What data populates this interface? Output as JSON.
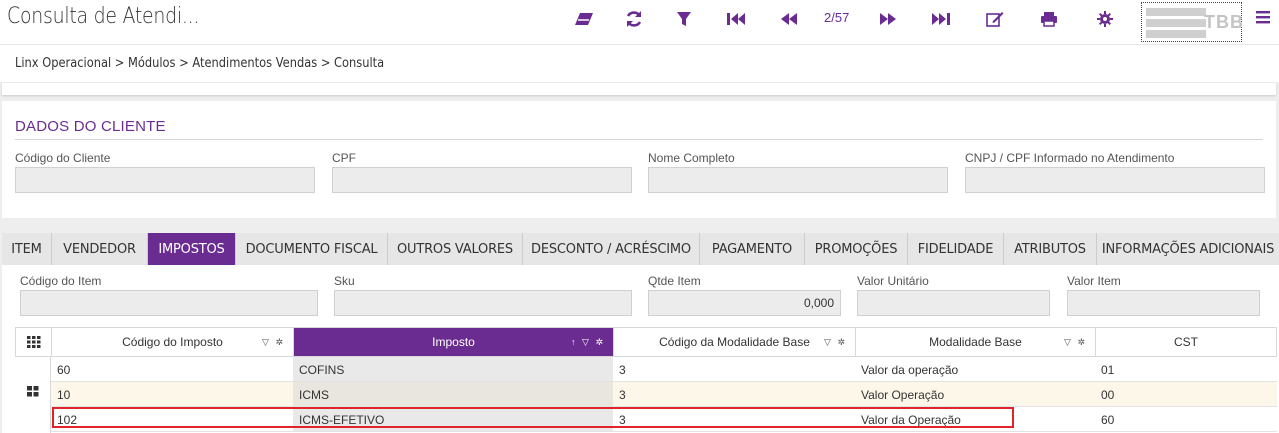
{
  "app": {
    "title": "Consulta de Atendi..."
  },
  "toolbar": {
    "pager": "2/57",
    "logo_text": "TBB",
    "icons": [
      "eraser-icon",
      "refresh-icon",
      "filter-icon",
      "first-icon",
      "prev-icon",
      "next-icon",
      "last-icon",
      "edit-icon",
      "print-icon",
      "gear-icon",
      "menu-icon"
    ]
  },
  "breadcrumb": "Linx Operacional  >  Módulos  >  Atendimentos Vendas  >  Consulta",
  "cliente": {
    "title": "DADOS DO CLIENTE",
    "fields": [
      {
        "label": "Código do Cliente",
        "value": ""
      },
      {
        "label": "CPF",
        "value": ""
      },
      {
        "label": "Nome Completo",
        "value": ""
      },
      {
        "label": "CNPJ / CPF Informado no Atendimento",
        "value": ""
      }
    ]
  },
  "tabs": [
    "ITEM",
    "VENDEDOR",
    "IMPOSTOS",
    "DOCUMENTO FISCAL",
    "OUTROS VALORES",
    "DESCONTO / ACRÉSCIMO",
    "PAGAMENTO",
    "PROMOÇÕES",
    "FIDELIDADE",
    "ATRIBUTOS",
    "INFORMAÇÕES ADICIONAIS"
  ],
  "active_tab": "IMPOSTOS",
  "item_fields": [
    {
      "label": "Código do Item",
      "value": ""
    },
    {
      "label": "Sku",
      "value": ""
    },
    {
      "label": "Qtde Item",
      "value": "0,000"
    },
    {
      "label": "Valor Unitário",
      "value": ""
    },
    {
      "label": "Valor Item",
      "value": ""
    }
  ],
  "grid": {
    "columns": [
      "Código do Imposto",
      "Imposto",
      "Código da Modalidade Base",
      "Modalidade Base",
      "CST"
    ],
    "sorted_column": "Imposto",
    "sort_icons": "↑ ▽ ✲",
    "col_icons": "▽ ✲",
    "rows": [
      [
        "60",
        "COFINS",
        "3",
        "Valor da operação",
        "01"
      ],
      [
        "10",
        "ICMS",
        "3",
        "Valor Operação",
        "00"
      ],
      [
        "102",
        "ICMS-EFETIVO",
        "3",
        "Valor da Operação",
        "60"
      ]
    ]
  },
  "colors": {
    "accent": "#6a2c91",
    "highlight": "#e0242a",
    "alt_row": "#fdf7ea"
  }
}
